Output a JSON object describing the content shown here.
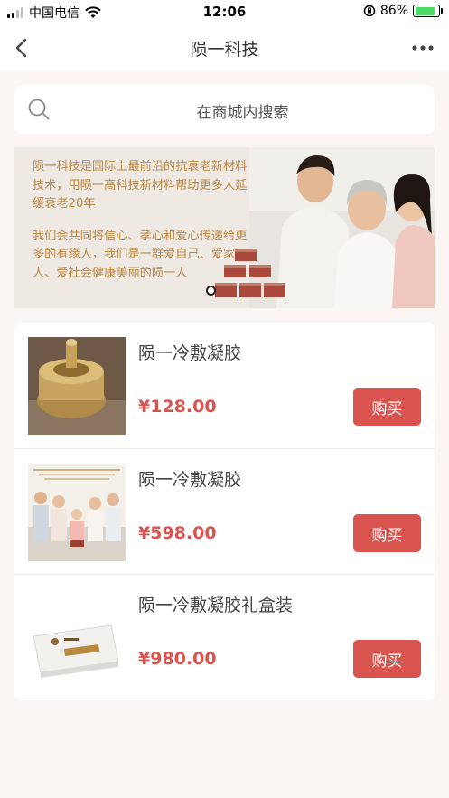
{
  "status_bar": {
    "carrier": "中国电信",
    "time": "12:06",
    "battery_percent": "86%",
    "battery_level": 0.86
  },
  "nav": {
    "title": "陨一科技",
    "back_icon": "chevron-left-icon",
    "more_icon": "ellipsis-icon"
  },
  "search": {
    "placeholder": "在商城内搜索",
    "icon": "search-icon"
  },
  "banner": {
    "paragraph_1": "陨一科技是国际上最前沿的抗衰老新材料技术，用陨一高科技新材料帮助更多人延缓衰老20年",
    "paragraph_2": "我们会共同将信心、孝心和爱心传递给更多的有缘人，我们是一群爱自己、爱家人、爱社会健康美丽的陨一人",
    "text_color": "#b78745"
  },
  "products": [
    {
      "name": "陨一冷敷凝胶",
      "price": "¥128.00",
      "buy_label": "购买"
    },
    {
      "name": "陨一冷敷凝胶",
      "price": "¥598.00",
      "buy_label": "购买"
    },
    {
      "name": "陨一冷敷凝胶礼盒装",
      "price": "¥980.00",
      "buy_label": "购买"
    }
  ],
  "colors": {
    "accent": "#d9534f",
    "background": "#fbf6f3"
  }
}
